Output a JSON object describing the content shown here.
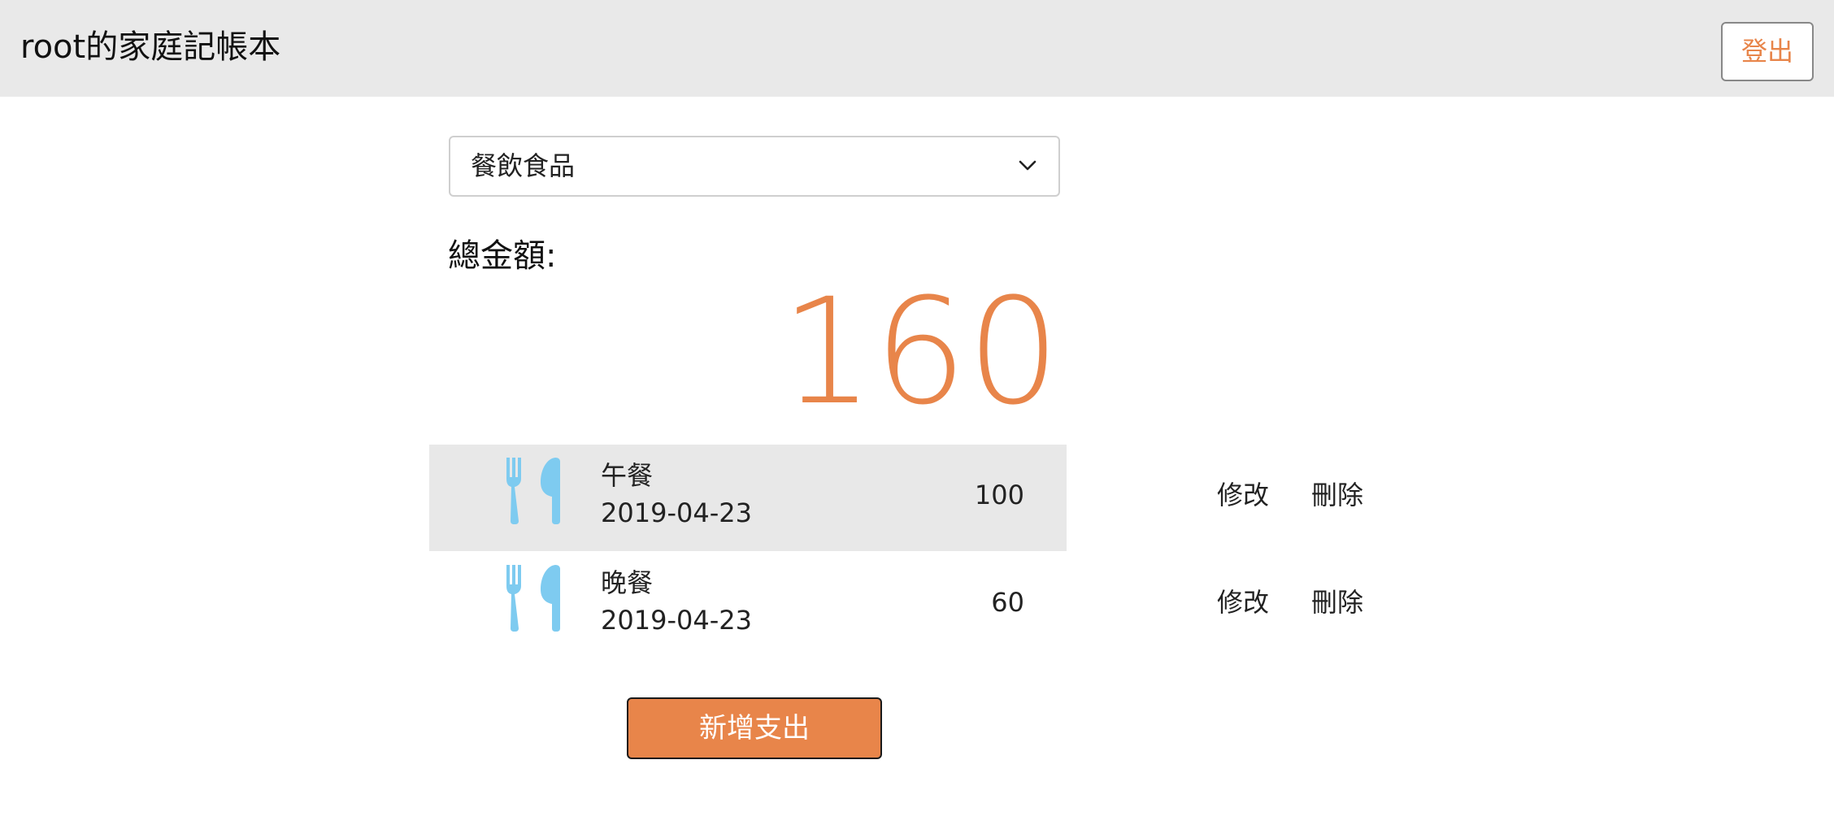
{
  "header": {
    "title": "root的家庭記帳本",
    "logout_label": "登出"
  },
  "filter": {
    "selected_category": "餐飲食品",
    "chevron_icon": "chevron-down-icon"
  },
  "summary": {
    "total_label": "總金額:",
    "total_value": "160"
  },
  "expenses": [
    {
      "icon": "fork-knife-icon",
      "name": "午餐",
      "date": "2019-04-23",
      "amount": "100",
      "edit_label": "修改",
      "delete_label": "刪除",
      "highlighted": true
    },
    {
      "icon": "fork-knife-icon",
      "name": "晚餐",
      "date": "2019-04-23",
      "amount": "60",
      "edit_label": "修改",
      "delete_label": "刪除",
      "highlighted": false
    }
  ],
  "actions": {
    "add_expense_label": "新增支出"
  },
  "colors": {
    "accent": "#e8854a",
    "header_bg": "#e9e9e9",
    "icon": "#7ecbf0",
    "row_highlight": "#e8e8e8"
  }
}
